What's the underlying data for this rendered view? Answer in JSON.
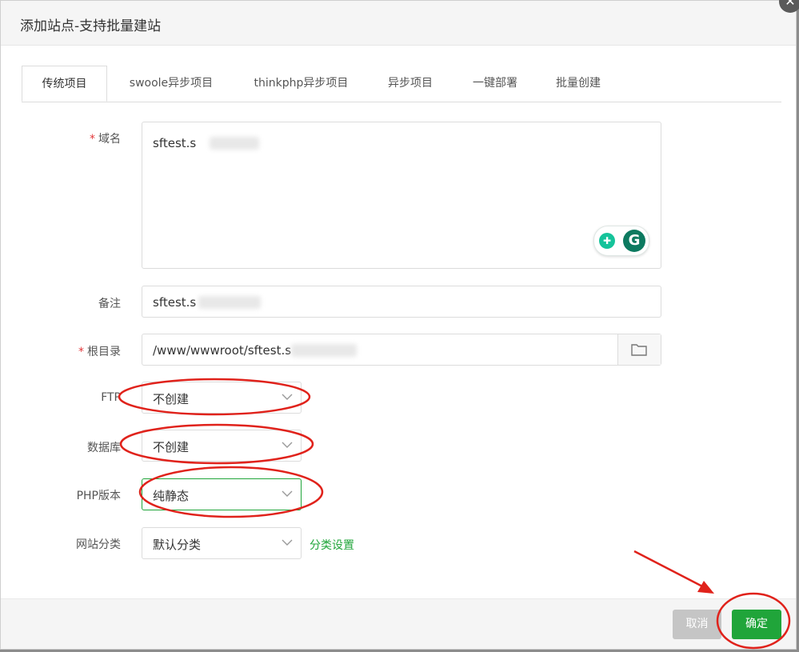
{
  "dialog": {
    "title": "添加站点-支持批量建站"
  },
  "tabs": [
    {
      "label": "传统项目"
    },
    {
      "label": "swoole异步项目"
    },
    {
      "label": "thinkphp异步项目"
    },
    {
      "label": "异步项目"
    },
    {
      "label": "一键部署"
    },
    {
      "label": "批量创建"
    }
  ],
  "form": {
    "domain": {
      "label": "域名",
      "value": "sftest.s"
    },
    "remark": {
      "label": "备注",
      "value": "sftest.s"
    },
    "root": {
      "label": "根目录",
      "value": "/www/wwwroot/sftest.s"
    },
    "ftp": {
      "label": "FTP",
      "value": "不创建"
    },
    "database": {
      "label": "数据库",
      "value": "不创建"
    },
    "php": {
      "label": "PHP版本",
      "value": "纯静态"
    },
    "category": {
      "label": "网站分类",
      "value": "默认分类",
      "link": "分类设置"
    }
  },
  "footer": {
    "cancel": "取消",
    "ok": "确定"
  },
  "colors": {
    "accent": "#20a53a",
    "annotation": "#e0221b"
  }
}
